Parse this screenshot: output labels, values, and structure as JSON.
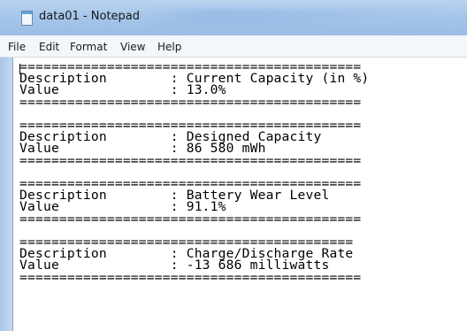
{
  "window": {
    "title": "data01 - Notepad"
  },
  "menu": {
    "items": [
      "File",
      "Edit",
      "Format",
      "View",
      "Help"
    ]
  },
  "document": {
    "text": "===========================================\nDescription        : Current Capacity (in %)\nValue              : 13.0%\n===========================================\n\n===========================================\nDescription        : Designed Capacity\nValue              : 86 580 mWh\n===========================================\n\n===========================================\nDescription        : Battery Wear Level\nValue              : 91.1%\n===========================================\n\n==========================================\nDescription        : Charge/Discharge Rate\nValue              : -13 686 milliwatts\n==========================================="
  },
  "icons": {
    "app": "notepad-icon"
  }
}
